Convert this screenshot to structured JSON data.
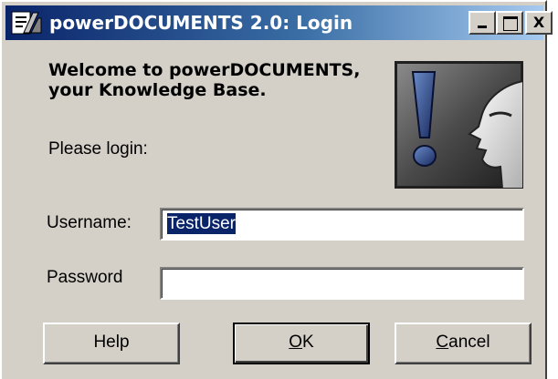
{
  "window": {
    "title": "powerDOCUMENTS 2.0: Login",
    "controls": {
      "minimize_icon": "minimize-icon",
      "maximize_icon": "maximize-icon",
      "close_label": "X"
    }
  },
  "content": {
    "welcome_line1": "Welcome to powerDOCUMENTS,",
    "welcome_line2": "your Knowledge Base.",
    "please_login": "Please login:",
    "logo_icon": "exclamation-face-logo"
  },
  "form": {
    "username_label": "Username:",
    "username_value": "TestUser",
    "password_label": "Password",
    "password_value": ""
  },
  "buttons": {
    "help_label": "Help",
    "ok_label": "OK",
    "cancel_label": "Cancel"
  },
  "colors": {
    "titlebar_start": "#0a246a",
    "titlebar_end": "#a6caf0",
    "dialog_face": "#d4d0c8",
    "selection": "#0a246a"
  }
}
